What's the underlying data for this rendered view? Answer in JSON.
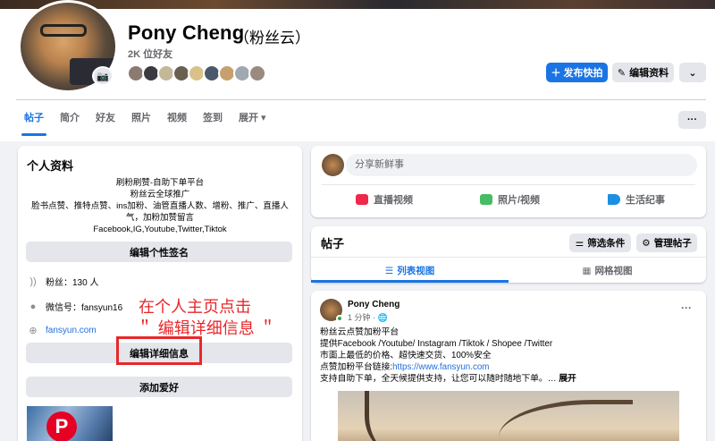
{
  "profile": {
    "name": "Pony Cheng",
    "alt_name": "（粉丝云）",
    "friends_count": "2K 位好友",
    "friend_face_colors": [
      "#8a7a70",
      "#3a3a40",
      "#c4b79a",
      "#6a6050",
      "#d9c28a",
      "#4a5a6a",
      "#c8a070",
      "#a0a8b0",
      "#9a8a80"
    ]
  },
  "actions": {
    "add_story": "＋ 发布快拍",
    "edit_profile": "编辑资料",
    "more": "⌄"
  },
  "tabs": [
    "帖子",
    "简介",
    "好友",
    "照片",
    "视频",
    "签到",
    "展开 ▾"
  ],
  "tab_more_menu": "···",
  "intro": {
    "title": "个人资料",
    "bio_lines": [
      "刷粉刷赞-自助下单平台",
      "粉丝云全球推广",
      "脸书点赞、推特点赞、ins加粉、油管直播人数、增粉、推广、直播人",
      "气，加粉加赞留言",
      "Facebook,IG,Youtube,Twitter,Tiktok"
    ],
    "edit_bio": "编辑个性签名",
    "followers": "粉丝：130 人",
    "wechat": "微信号：fansyun16",
    "website": "fansyun.com",
    "edit_details": "编辑详细信息",
    "add_hobbies": "添加爱好",
    "annotation_line1": "在个人主页点击",
    "annotation_line2": "＂ 编辑详细信息 ＂"
  },
  "composer": {
    "placeholder": "分享新鲜事",
    "live": "直播视频",
    "photo": "照片/视频",
    "event": "生活纪事"
  },
  "posts": {
    "title": "帖子",
    "filter": "筛选条件",
    "manage": "管理帖子",
    "list_view": "列表视图",
    "grid_view": "网格视图"
  },
  "post": {
    "author": "Pony Cheng",
    "time": "1 分钟 · 🌐",
    "line1": "粉丝云点赞加粉平台",
    "line2": "提供Facebook /Youtube/ Instagram /Tiktok / Shopee /Twitter",
    "line3": "市面上最低的价格、超快速交货、100%安全",
    "line4_prefix": "点赞加粉平台链接:",
    "line4_link": "https://www.fansyun.com",
    "line5": "支持自助下单，全天候提供支持，让您可以随时随地下单。…",
    "expand": "展开"
  },
  "colors": {
    "accent": "#1b74e4",
    "annotation": "#e8272a"
  }
}
